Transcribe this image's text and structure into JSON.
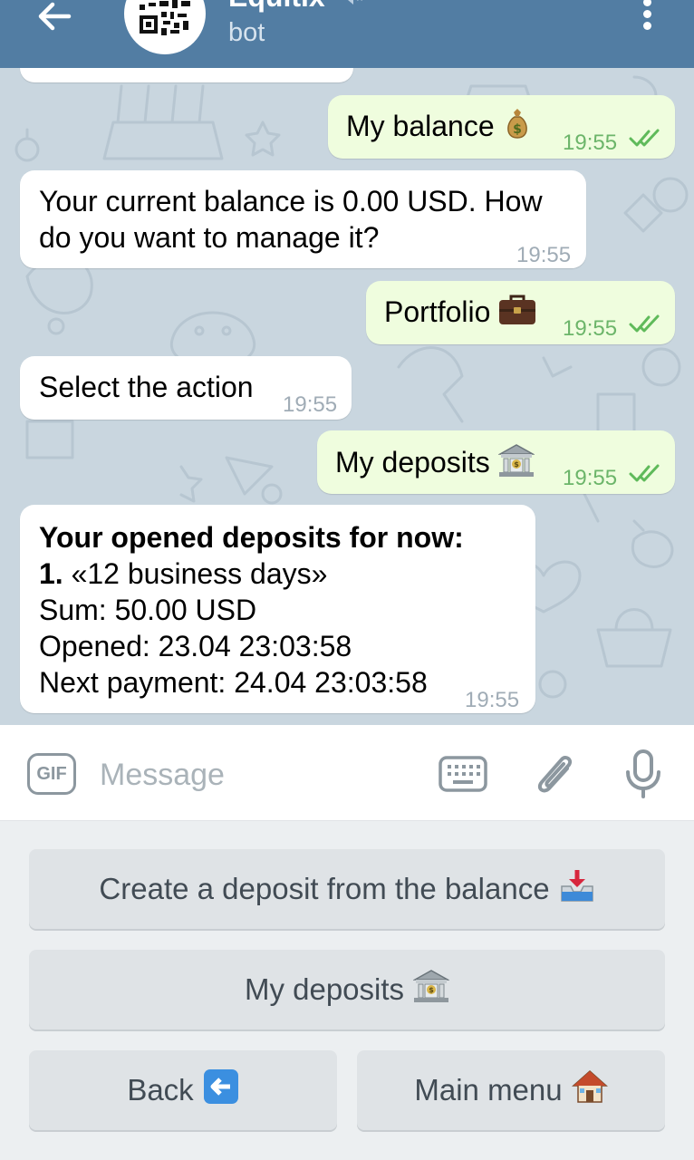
{
  "header": {
    "title": "Equitix",
    "subtitle": "bot"
  },
  "messages": [
    {
      "dir": "out",
      "text": "My balance",
      "emoji": "money-bag-emoji",
      "time": "19:55"
    },
    {
      "dir": "in",
      "lines": [
        "Your current balance is 0.00 USD. How",
        "do you want to manage it?"
      ],
      "time": "19:55"
    },
    {
      "dir": "out",
      "text": "Portfolio",
      "emoji": "briefcase-emoji",
      "time": "19:55"
    },
    {
      "dir": "in",
      "text": "Select the action",
      "time": "19:55"
    },
    {
      "dir": "out",
      "text": "My deposits",
      "emoji": "bank-emoji",
      "time": "19:55"
    },
    {
      "dir": "in",
      "title": "Your opened deposits for now:",
      "item_number": "1.",
      "item_name": " «12 business days»",
      "sum": "Sum: 50.00 USD",
      "opened": "Opened: 23.04 23:03:58",
      "next_payment": "Next payment: 24.04 23:03:58",
      "time": "19:55"
    }
  ],
  "input": {
    "gif_label": "GIF",
    "placeholder": "Message"
  },
  "keyboard": {
    "create_deposit": "Create a deposit from the balance",
    "my_deposits": "My deposits",
    "back": "Back",
    "main_menu": "Main menu"
  },
  "colors": {
    "header": "#527da3",
    "outgoing_bubble": "#effdde",
    "incoming_bubble": "#ffffff",
    "read_ticks": "#5fba5a",
    "keyboard_button": "#dfe3e6"
  }
}
